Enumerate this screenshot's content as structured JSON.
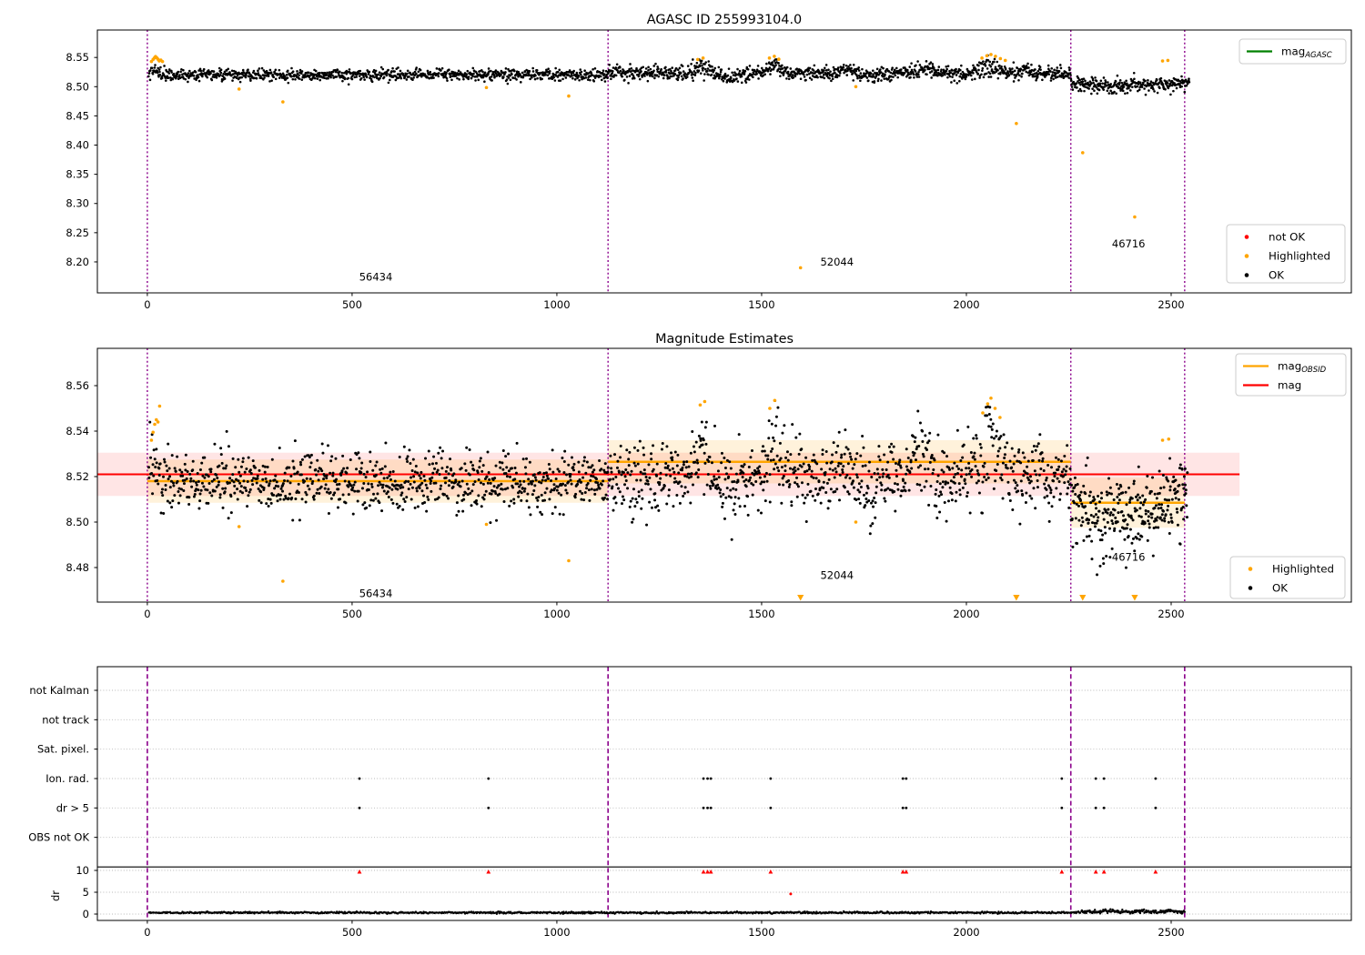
{
  "figure": {
    "background": "#ffffff"
  },
  "colors": {
    "ok": "#000000",
    "highlighted": "#ffa500",
    "not_ok": "#ff0000",
    "mag_line": "#ff0000",
    "obsid_line": "#ffa500",
    "agasc_line": "#008000",
    "divider": "#8b008b",
    "grid": "#b8b8b8",
    "spine": "#000000",
    "red_band": "rgba(255,0,0,0.10)",
    "orange_band": "rgba(255,165,0,0.14)"
  },
  "chart_data": [
    {
      "type": "scatter",
      "title": "AGASC ID 255993104.0",
      "xlim": [
        -122,
        2940
      ],
      "ylim": [
        8.147,
        8.597
      ],
      "xticks": [
        0,
        500,
        1000,
        1500,
        2000,
        2500
      ],
      "yticks": [
        8.2,
        8.25,
        8.3,
        8.35,
        8.4,
        8.45,
        8.5,
        8.55
      ],
      "dividers": [
        0,
        1125,
        2255,
        2533
      ],
      "annotations": [
        {
          "text": "56434",
          "x": 558,
          "y": 8.168
        },
        {
          "text": "52044",
          "x": 1684,
          "y": 8.194
        },
        {
          "text": "46716",
          "x": 2396,
          "y": 8.225
        }
      ],
      "legend_top": {
        "entries": [
          {
            "kind": "line",
            "color_key": "agasc_line",
            "label": "mag",
            "sub": "AGASC"
          }
        ]
      },
      "legend_bottom": {
        "entries": [
          {
            "kind": "dot",
            "color_key": "not_ok",
            "label": "not OK"
          },
          {
            "kind": "dot",
            "color_key": "highlighted",
            "label": "Highlighted"
          },
          {
            "kind": "dot",
            "color_key": "ok",
            "label": "OK"
          }
        ]
      },
      "ok_segments": [
        {
          "x0": 3,
          "x1": 1125,
          "n": 1000,
          "mean": 8.5205,
          "std": 0.005,
          "bumps": [
            {
              "c": 15,
              "w": 18,
              "a": 0.013
            }
          ]
        },
        {
          "x0": 1125,
          "x1": 2255,
          "n": 1100,
          "mean": 8.5225,
          "std": 0.0058,
          "bumps": [
            {
              "c": 1355,
              "w": 22,
              "a": 0.021
            },
            {
              "c": 1530,
              "w": 18,
              "a": 0.023
            },
            {
              "c": 1705,
              "w": 16,
              "a": 0.012
            },
            {
              "c": 1900,
              "w": 26,
              "a": 0.015
            },
            {
              "c": 2058,
              "w": 34,
              "a": 0.025
            },
            {
              "c": 2145,
              "w": 14,
              "a": 0.013
            },
            {
              "c": 1425,
              "w": 26,
              "a": -0.009
            },
            {
              "c": 1755,
              "w": 22,
              "a": -0.009
            }
          ]
        },
        {
          "x0": 2255,
          "x1": 2545,
          "n": 300,
          "mean": 8.5035,
          "std": 0.0062,
          "bumps": [
            {
              "c": 2530,
              "w": 22,
              "a": 0.011
            },
            {
              "c": 2350,
              "w": 45,
              "a": -0.006
            }
          ]
        }
      ],
      "highlighted_points": [
        [
          10,
          8.543
        ],
        [
          14,
          8.5465
        ],
        [
          17,
          8.549
        ],
        [
          20,
          8.5515
        ],
        [
          23,
          8.5495
        ],
        [
          26,
          8.547
        ],
        [
          29,
          8.544
        ],
        [
          33,
          8.5455
        ],
        [
          37,
          8.543
        ],
        [
          224,
          8.496
        ],
        [
          331,
          8.474
        ],
        [
          828,
          8.4985
        ],
        [
          1029,
          8.484
        ],
        [
          1344,
          8.5465
        ],
        [
          1357,
          8.549
        ],
        [
          1519,
          8.549
        ],
        [
          1531,
          8.552
        ],
        [
          1542,
          8.547
        ],
        [
          1595,
          8.19
        ],
        [
          1730,
          8.5
        ],
        [
          2038,
          8.549
        ],
        [
          2050,
          8.553
        ],
        [
          2060,
          8.555
        ],
        [
          2071,
          8.552
        ],
        [
          2083,
          8.548
        ],
        [
          2095,
          8.545
        ],
        [
          2122,
          8.437
        ],
        [
          2284,
          8.387
        ],
        [
          2411,
          8.277
        ],
        [
          2479,
          8.544
        ],
        [
          2492,
          8.545
        ]
      ]
    },
    {
      "type": "scatter",
      "title": "Magnitude Estimates",
      "xlim": [
        -122,
        2940
      ],
      "ylim": [
        8.4648,
        8.5764
      ],
      "xticks": [
        0,
        500,
        1000,
        1500,
        2000,
        2500
      ],
      "yticks": [
        8.48,
        8.5,
        8.52,
        8.54,
        8.56
      ],
      "dividers": [
        0,
        1125,
        2255,
        2533
      ],
      "annotations": [
        {
          "text": "56434",
          "x": 558,
          "y": 8.467
        },
        {
          "text": "52044",
          "x": 1684,
          "y": 8.475
        },
        {
          "text": "46716",
          "x": 2396,
          "y": 8.483
        }
      ],
      "legend_top": {
        "entries": [
          {
            "kind": "line",
            "color_key": "obsid_line",
            "label": "mag",
            "sub": "OBSID"
          },
          {
            "kind": "line",
            "color_key": "mag_line",
            "label": "mag",
            "sub": ""
          }
        ]
      },
      "legend_bottom": {
        "entries": [
          {
            "kind": "dot",
            "color_key": "highlighted",
            "label": "Highlighted"
          },
          {
            "kind": "dot",
            "color_key": "ok",
            "label": "OK"
          }
        ]
      },
      "mag_line": {
        "value": 8.521,
        "band": 0.0095,
        "x0": -122,
        "x1": 2667
      },
      "obsid_lines": [
        {
          "x0": 0,
          "x1": 1125,
          "value": 8.518,
          "band": 0.0095
        },
        {
          "x0": 1125,
          "x1": 2255,
          "value": 8.5265,
          "band": 0.0095
        },
        {
          "x0": 2255,
          "x1": 2533,
          "value": 8.5085,
          "band": 0.011
        }
      ],
      "ok_segments": [
        {
          "x0": 3,
          "x1": 1125,
          "n": 860,
          "mean": 8.5175,
          "std": 0.0066,
          "bumps": [
            {
              "c": 14,
              "w": 14,
              "a": 0.024
            }
          ]
        },
        {
          "x0": 1125,
          "x1": 2255,
          "n": 880,
          "mean": 8.52,
          "std": 0.0078,
          "bumps": [
            {
              "c": 1355,
              "w": 20,
              "a": 0.03
            },
            {
              "c": 1532,
              "w": 18,
              "a": 0.03
            },
            {
              "c": 1700,
              "w": 16,
              "a": 0.017
            },
            {
              "c": 1880,
              "w": 26,
              "a": 0.021
            },
            {
              "c": 2058,
              "w": 30,
              "a": 0.031
            },
            {
              "c": 2170,
              "w": 14,
              "a": 0.017
            },
            {
              "c": 1430,
              "w": 26,
              "a": -0.01
            },
            {
              "c": 1760,
              "w": 20,
              "a": -0.011
            }
          ]
        },
        {
          "x0": 2255,
          "x1": 2540,
          "n": 300,
          "mean": 8.505,
          "std": 0.0082,
          "bumps": [
            {
              "c": 2520,
              "w": 18,
              "a": 0.013
            },
            {
              "c": 2350,
              "w": 45,
              "a": -0.008
            }
          ]
        }
      ],
      "highlighted_points": [
        [
          10,
          8.536
        ],
        [
          14,
          8.5395
        ],
        [
          18,
          8.543
        ],
        [
          22,
          8.545
        ],
        [
          26,
          8.544
        ],
        [
          30,
          8.551
        ],
        [
          224,
          8.498
        ],
        [
          331,
          8.474
        ],
        [
          828,
          8.499
        ],
        [
          1029,
          8.483
        ],
        [
          1350,
          8.5515
        ],
        [
          1361,
          8.553
        ],
        [
          1520,
          8.55
        ],
        [
          1532,
          8.5535
        ],
        [
          1730,
          8.5
        ],
        [
          2040,
          8.548
        ],
        [
          2052,
          8.552
        ],
        [
          2060,
          8.5545
        ],
        [
          2070,
          8.55
        ],
        [
          2082,
          8.546
        ],
        [
          2479,
          8.536
        ],
        [
          2494,
          8.5365
        ]
      ],
      "clip_low_x": [
        1595,
        2122,
        2284,
        2411
      ]
    },
    {
      "type": "scatter",
      "title": "",
      "xlim": [
        -122,
        2940
      ],
      "xticks": [
        0,
        500,
        1000,
        1500,
        2000,
        2500
      ],
      "rows": [
        "not Kalman",
        "not track",
        "Sat. pixel.",
        "Ion. rad.",
        "dr > 5",
        "OBS not OK"
      ],
      "dr_axis": {
        "label": "dr",
        "ticks": [
          10,
          5,
          0
        ],
        "cap": 10.8
      },
      "dividers": [
        0,
        1125,
        2255,
        2533
      ],
      "flag_events": {
        "row_indices": [
          3,
          4
        ],
        "x_groups": [
          [
            518
          ],
          [
            833
          ],
          [
            1358,
            1368,
            1376
          ],
          [
            1522
          ],
          [
            1845,
            1853
          ],
          [
            2233
          ],
          [
            2316,
            2336
          ],
          [
            2462
          ]
        ]
      },
      "red_events": {
        "dr": 9.7,
        "x_groups": [
          [
            518
          ],
          [
            833
          ],
          [
            1358,
            1368,
            1376
          ],
          [
            1522
          ],
          [
            1845,
            1853
          ],
          [
            2233
          ],
          [
            2316,
            2336
          ],
          [
            2462
          ]
        ]
      },
      "red_outlier": {
        "x": 1571,
        "dr": 4.6
      },
      "dr_segments": [
        {
          "x0": 3,
          "x1": 2280,
          "n": 1100,
          "mean": 0.32,
          "std": 0.1,
          "min": 0.05,
          "max": 0.95
        },
        {
          "x0": 2280,
          "x1": 2533,
          "n": 180,
          "mean": 0.5,
          "std": 0.18,
          "min": 0.1,
          "max": 1.4,
          "bumps": [
            {
              "c": 2350,
              "w": 18,
              "a": 0.5
            },
            {
              "c": 2430,
              "w": 15,
              "a": 0.35
            },
            {
              "c": 2495,
              "w": 15,
              "a": 0.45
            }
          ]
        }
      ]
    }
  ]
}
